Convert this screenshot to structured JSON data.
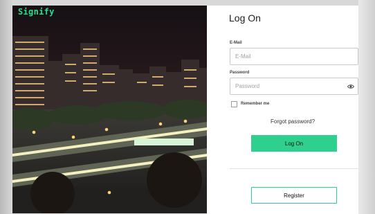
{
  "brand": {
    "logo_text": "Signify",
    "accent_color": "#2fd08d"
  },
  "hero": {
    "image": "night-city-intersection"
  },
  "login": {
    "title": "Log On",
    "email": {
      "label": "E-Mail",
      "placeholder": "E-Mail",
      "value": ""
    },
    "password": {
      "label": "Password",
      "placeholder": "Password",
      "value": "",
      "toggle_icon": "eye-icon"
    },
    "remember_me": {
      "label": "Remember me",
      "checked": false
    },
    "forgot_password": "Forgot password?",
    "submit_label": "Log On",
    "register_label": "Register"
  }
}
